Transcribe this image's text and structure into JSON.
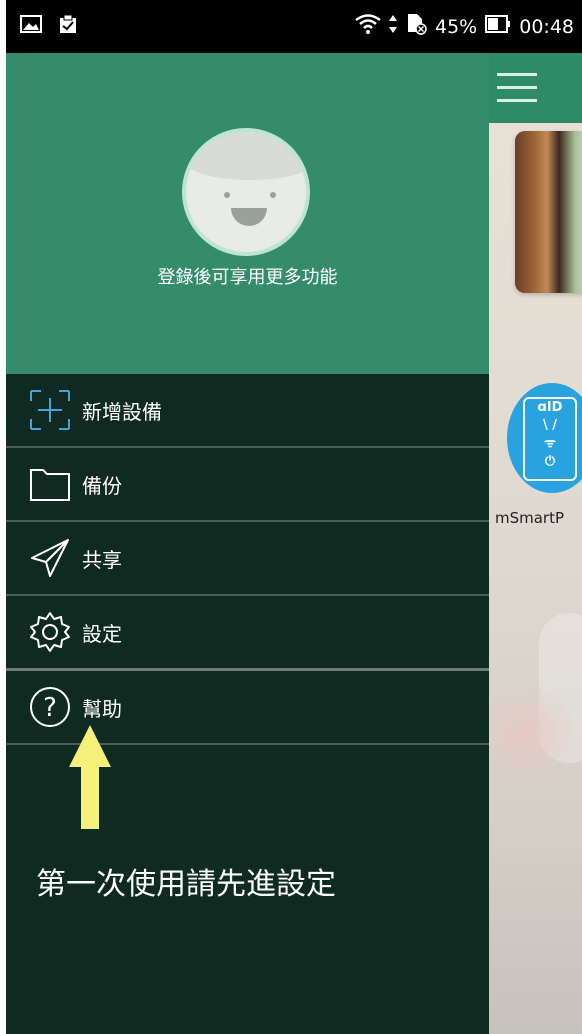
{
  "status_bar": {
    "battery_percent": "45%",
    "time": "00:48"
  },
  "drawer": {
    "login_prompt": "登錄後可享用更多功能",
    "menu_items": [
      {
        "label": "新增設備",
        "icon": "add-device-icon"
      },
      {
        "label": "備份",
        "icon": "folder-icon"
      },
      {
        "label": "共享",
        "icon": "share-send-icon"
      },
      {
        "label": "設定",
        "icon": "gear-icon"
      },
      {
        "label": "幫助",
        "icon": "help-question-icon"
      }
    ],
    "hint_text": "第一次使用請先進設定"
  },
  "background_app": {
    "device_label": "mSmartP"
  },
  "colors": {
    "header_green": "#358c6c",
    "drawer_dark": "#0f2a20",
    "hint_arrow_yellow": "#f5f07a",
    "device_blue": "#29a3e0"
  }
}
